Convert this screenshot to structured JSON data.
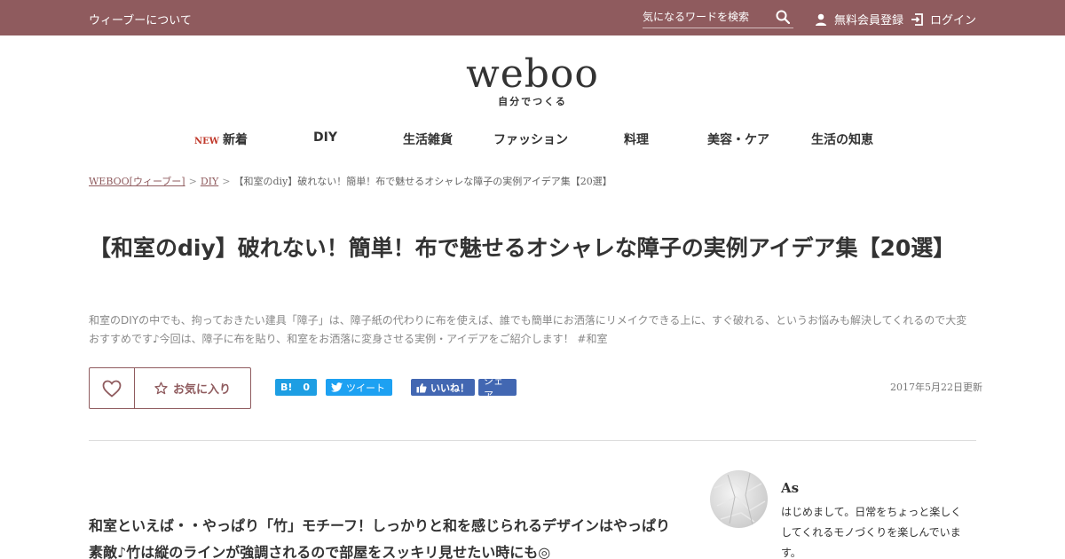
{
  "header": {
    "about": "ウィーブーについて",
    "search_placeholder": "気になるワードを検索",
    "register": "無料会員登録",
    "login": "ログイン"
  },
  "logo": {
    "word": "weboo",
    "tagline": "自分でつくる"
  },
  "nav": {
    "new_badge": "NEW",
    "items": [
      "新着",
      "DIY",
      "生活雑貨",
      "ファッション",
      "料理",
      "美容・ケア",
      "生活の知恵"
    ]
  },
  "breadcrumb": {
    "home": "WEBOO[ウィーブー]",
    "category": "DIY",
    "current": "【和室のdiy】破れない！簡単！布で魅せるオシャレな障子の実例アイデア集【20選】",
    "separator": ">"
  },
  "article": {
    "title": "【和室のdiy】破れない！簡単！布で魅せるオシャレな障子の実例アイデア集【20選】",
    "lead": "和室のDIYの中でも、拘っておきたい建具「障子」は、障子紙の代わりに布を使えば、誰でも簡単にお洒落にリメイクできる上に、すぐ破れる、というお悩みも解決してくれるので大変おすすめです♪今回は、障子に布を貼り、和室をお洒落に変身させる実例・アイデアをご紹介します！ #和室",
    "favorite_label": "お気に入り",
    "updated": "2017年5月22日更新",
    "body": "和室といえば・・やっぱり「竹」モチーフ！しっかりと和を感じられるデザインはやっぱり素敵♪竹は縦のラインが強調されるので部屋をスッキリ見せたい時にも◎"
  },
  "share": {
    "hatena_label": "B!",
    "hatena_count": "0",
    "tweet_label": "ツイート",
    "like_label": "いいね！",
    "share_label": "シェア"
  },
  "author": {
    "name": "As",
    "bio": "はじめまして。日常をちょっと楽しくしてくれるモノづくりを楽しんでいます。"
  },
  "colors": {
    "brand": "#8f5b5e",
    "twitter": "#1da1f2",
    "facebook": "#4267b2",
    "hatena": "#1d9ee3"
  }
}
